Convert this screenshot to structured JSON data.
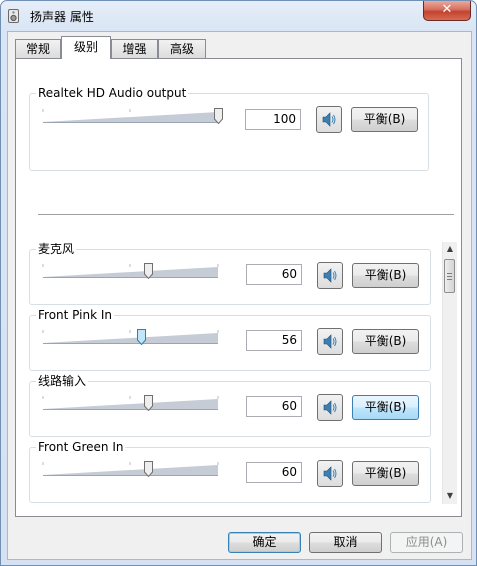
{
  "window": {
    "title": "扬声器 属性",
    "close_label": "✕"
  },
  "tabs": [
    {
      "label": "常规",
      "active": false
    },
    {
      "label": "级别",
      "active": true
    },
    {
      "label": "增强",
      "active": false
    },
    {
      "label": "高级",
      "active": false
    }
  ],
  "output_group": {
    "label": "Realtek HD Audio output",
    "value": "100",
    "level": 100,
    "balance_label": "平衡(B)"
  },
  "inputs": [
    {
      "label": "麦克风",
      "value": "60",
      "level": 60,
      "balance_label": "平衡(B)"
    },
    {
      "label": "Front Pink In",
      "value": "56",
      "level": 56,
      "balance_label": "平衡(B)"
    },
    {
      "label": "线路输入",
      "value": "60",
      "level": 60,
      "balance_label": "平衡(B)"
    },
    {
      "label": "Front Green In",
      "value": "60",
      "level": 60,
      "balance_label": "平衡(B)"
    }
  ],
  "buttons": {
    "ok": "确定",
    "cancel": "取消",
    "apply": "应用(A)"
  },
  "icons": {
    "window": "speaker-properties-icon",
    "mute": "speaker-icon"
  },
  "colors": {
    "accent": "#3c7fb1",
    "close": "#c24330"
  }
}
